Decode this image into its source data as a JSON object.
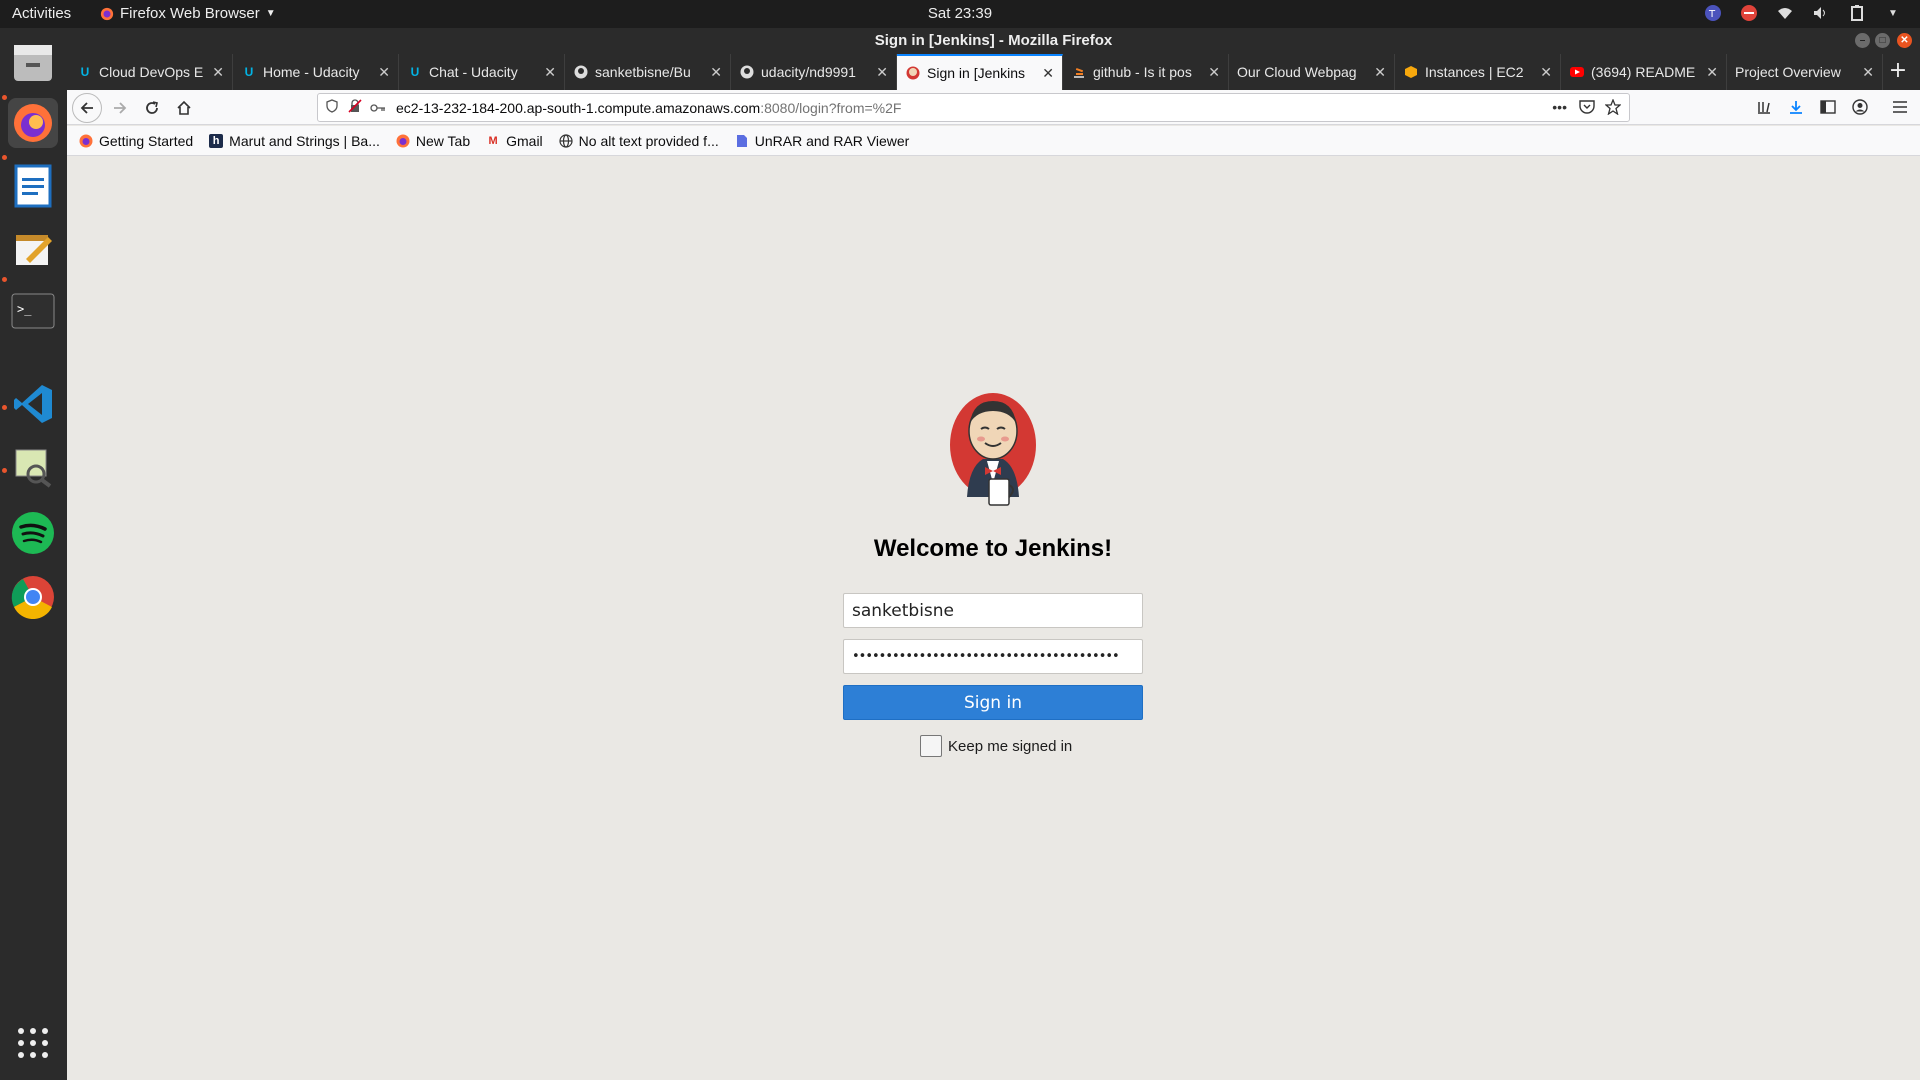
{
  "topbar": {
    "activities": "Activities",
    "app_name": "Firefox Web Browser",
    "clock": "Sat 23:39"
  },
  "dock": {
    "items": [
      "files-icon",
      "firefox-icon",
      "writer-icon",
      "text-editor-icon",
      "terminal-icon",
      "vscode-icon",
      "image-viewer-icon",
      "spotify-icon",
      "chrome-icon",
      "apps-grid-icon"
    ]
  },
  "window": {
    "title": "Sign in [Jenkins] - Mozilla Firefox"
  },
  "tabs": [
    {
      "label": "Cloud DevOps E",
      "icon": "udacity-icon",
      "active": false
    },
    {
      "label": "Home - Udacity",
      "icon": "udacity-icon",
      "active": false
    },
    {
      "label": "Chat - Udacity",
      "icon": "udacity-icon",
      "active": false
    },
    {
      "label": "sanketbisne/Bu",
      "icon": "github-icon",
      "active": false
    },
    {
      "label": "udacity/nd9991",
      "icon": "github-icon",
      "active": false
    },
    {
      "label": "Sign in [Jenkins",
      "icon": "jenkins-icon",
      "active": true
    },
    {
      "label": "github - Is it pos",
      "icon": "stackoverflow-icon",
      "active": false
    },
    {
      "label": "Our Cloud Webpag",
      "icon": "none",
      "active": false
    },
    {
      "label": "Instances | EC2",
      "icon": "aws-icon",
      "active": false
    },
    {
      "label": "(3694) README",
      "icon": "youtube-icon",
      "active": false
    },
    {
      "label": "Project Overview",
      "icon": "none",
      "active": false
    }
  ],
  "url": {
    "host": "ec2-13-232-184-200.ap-south-1.compute.amazonaws.com",
    "path": ":8080/login?from=%2F"
  },
  "bookmarks": [
    {
      "label": "Getting Started",
      "icon": "firefox-icon"
    },
    {
      "label": "Marut and Strings | Ba...",
      "icon": "hashnode-icon"
    },
    {
      "label": "New Tab",
      "icon": "firefox-icon"
    },
    {
      "label": "Gmail",
      "icon": "gmail-icon"
    },
    {
      "label": "No alt text provided f...",
      "icon": "globe-icon"
    },
    {
      "label": "UnRAR and RAR Viewer",
      "icon": "document-icon"
    }
  ],
  "login": {
    "heading": "Welcome to Jenkins!",
    "username": "sanketbisne",
    "password_mask": "••••••••••••••••••••••••••••••••••••••••",
    "signin_label": "Sign in",
    "keep_signed_in_label": "Keep me signed in"
  },
  "colors": {
    "accent": "#0a84ff",
    "signin_button": "#2d7fd6",
    "page_background": "#eae8e4"
  }
}
